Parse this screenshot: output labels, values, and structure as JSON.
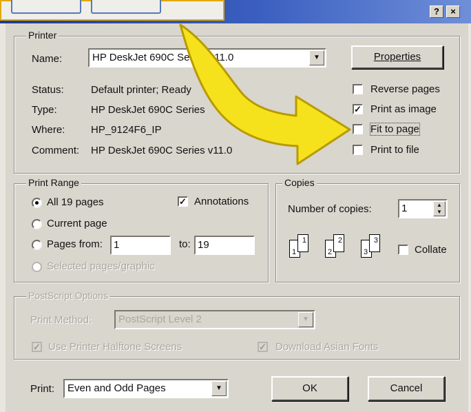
{
  "titlebar": {
    "help_glyph": "?",
    "close_glyph": "×"
  },
  "printer": {
    "group_label": "Printer",
    "name_label": "Name:",
    "name_value": "HP DeskJet 690C Series v11.0",
    "properties_label": "Properties",
    "status_label": "Status:",
    "status_value": "Default printer; Ready",
    "type_label": "Type:",
    "type_value": "HP DeskJet 690C Series",
    "where_label": "Where:",
    "where_value": "HP_9124F6_IP",
    "comment_label": "Comment:",
    "comment_value": "HP DeskJet 690C Series v11.0",
    "options": [
      {
        "label": "Reverse pages",
        "checked": false
      },
      {
        "label": "Print as image",
        "checked": true
      },
      {
        "label": "Fit to page",
        "checked": false
      },
      {
        "label": "Print to file",
        "checked": false
      }
    ]
  },
  "print_range": {
    "group_label": "Print Range",
    "all_pages": "All 19 pages",
    "current_page": "Current page",
    "pages_from": "Pages from:",
    "from_value": "1",
    "to_label": "to:",
    "to_value": "19",
    "selected_pages": "Selected pages/graphic",
    "annotations": "Annotations",
    "annotations_checked": true
  },
  "copies": {
    "group_label": "Copies",
    "number_label": "Number of copies:",
    "number_value": "1",
    "collate": "Collate",
    "collate_checked": false,
    "icon_digits": [
      "1",
      "1",
      "2",
      "2",
      "3",
      "3"
    ]
  },
  "postscript": {
    "group_label": "PostScript Options",
    "method_label": "Print Method:",
    "method_value": "PostScript Level 2",
    "halftone": "Use Printer Halftone Screens",
    "asian_fonts": "Download Asian Fonts"
  },
  "footer": {
    "print_label": "Print:",
    "print_value": "Even and Odd Pages",
    "ok": "OK",
    "cancel": "Cancel"
  },
  "colors": {
    "arrow_fill": "#f5e21c",
    "arrow_stroke": "#b89a00",
    "popup_border": "#e1a900"
  }
}
